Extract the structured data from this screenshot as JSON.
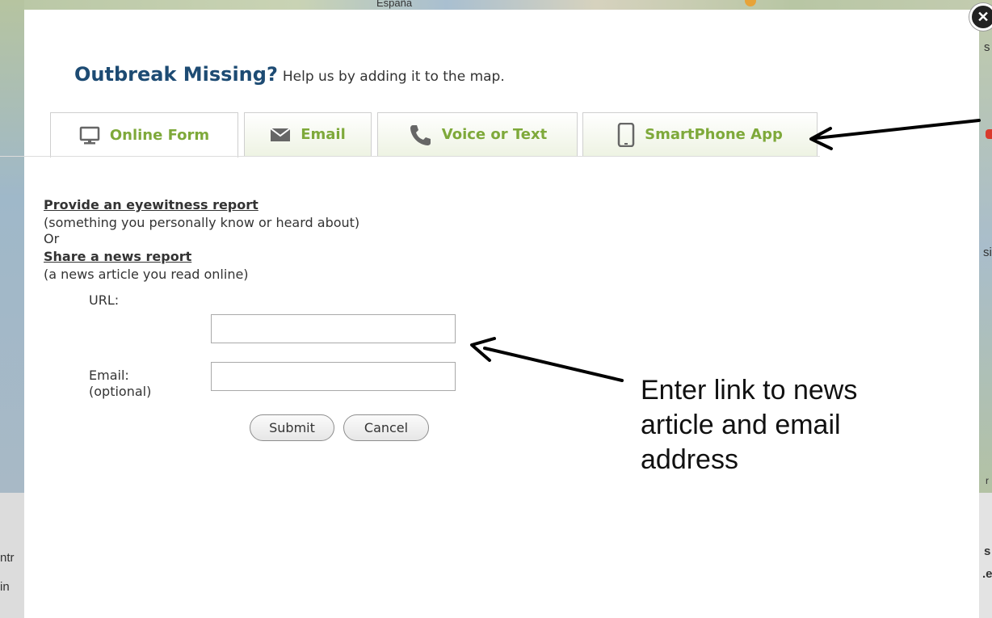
{
  "background": {
    "map_label": "España",
    "left_edge_text": [
      "ntr",
      "in"
    ],
    "right_edge_text": [
      "s",
      "si",
      "s",
      ".e",
      "r"
    ]
  },
  "modal": {
    "close_label": "✕",
    "heading": {
      "strong": "Outbreak Missing?",
      "rest": "Help us by adding it to the map."
    },
    "tabs": [
      {
        "label": "Online Form",
        "icon": "monitor-icon",
        "active": true
      },
      {
        "label": "Email",
        "icon": "envelope-icon",
        "active": false
      },
      {
        "label": "Voice or Text",
        "icon": "phone-icon",
        "active": false
      },
      {
        "label": "SmartPhone App",
        "icon": "smartphone-icon",
        "active": false
      }
    ],
    "form": {
      "eyewitness_link": "Provide an eyewitness report",
      "eyewitness_desc": "(something you personally know or heard about)",
      "or_text": "Or",
      "news_link": "Share a news report",
      "news_desc": "(a news article you read online)",
      "url_label": "URL:",
      "url_value": "",
      "email_label_line1": "Email:",
      "email_label_line2": "(optional)",
      "email_value": "",
      "submit_label": "Submit",
      "cancel_label": "Cancel"
    }
  },
  "annotation": {
    "line1": "Enter link to news",
    "line2": "article and email",
    "line3": "address"
  },
  "colors": {
    "heading_blue": "#1d4b73",
    "tab_green": "#7ea93a",
    "text": "#333333"
  }
}
